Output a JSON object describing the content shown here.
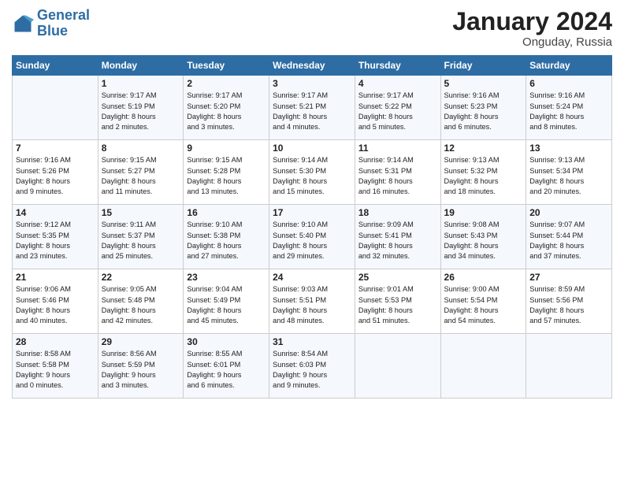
{
  "logo": {
    "line1": "General",
    "line2": "Blue"
  },
  "title": "January 2024",
  "location": "Onguday, Russia",
  "days_of_week": [
    "Sunday",
    "Monday",
    "Tuesday",
    "Wednesday",
    "Thursday",
    "Friday",
    "Saturday"
  ],
  "weeks": [
    [
      {
        "day": "",
        "info": ""
      },
      {
        "day": "1",
        "info": "Sunrise: 9:17 AM\nSunset: 5:19 PM\nDaylight: 8 hours\nand 2 minutes."
      },
      {
        "day": "2",
        "info": "Sunrise: 9:17 AM\nSunset: 5:20 PM\nDaylight: 8 hours\nand 3 minutes."
      },
      {
        "day": "3",
        "info": "Sunrise: 9:17 AM\nSunset: 5:21 PM\nDaylight: 8 hours\nand 4 minutes."
      },
      {
        "day": "4",
        "info": "Sunrise: 9:17 AM\nSunset: 5:22 PM\nDaylight: 8 hours\nand 5 minutes."
      },
      {
        "day": "5",
        "info": "Sunrise: 9:16 AM\nSunset: 5:23 PM\nDaylight: 8 hours\nand 6 minutes."
      },
      {
        "day": "6",
        "info": "Sunrise: 9:16 AM\nSunset: 5:24 PM\nDaylight: 8 hours\nand 8 minutes."
      }
    ],
    [
      {
        "day": "7",
        "info": "Sunrise: 9:16 AM\nSunset: 5:26 PM\nDaylight: 8 hours\nand 9 minutes."
      },
      {
        "day": "8",
        "info": "Sunrise: 9:15 AM\nSunset: 5:27 PM\nDaylight: 8 hours\nand 11 minutes."
      },
      {
        "day": "9",
        "info": "Sunrise: 9:15 AM\nSunset: 5:28 PM\nDaylight: 8 hours\nand 13 minutes."
      },
      {
        "day": "10",
        "info": "Sunrise: 9:14 AM\nSunset: 5:30 PM\nDaylight: 8 hours\nand 15 minutes."
      },
      {
        "day": "11",
        "info": "Sunrise: 9:14 AM\nSunset: 5:31 PM\nDaylight: 8 hours\nand 16 minutes."
      },
      {
        "day": "12",
        "info": "Sunrise: 9:13 AM\nSunset: 5:32 PM\nDaylight: 8 hours\nand 18 minutes."
      },
      {
        "day": "13",
        "info": "Sunrise: 9:13 AM\nSunset: 5:34 PM\nDaylight: 8 hours\nand 20 minutes."
      }
    ],
    [
      {
        "day": "14",
        "info": "Sunrise: 9:12 AM\nSunset: 5:35 PM\nDaylight: 8 hours\nand 23 minutes."
      },
      {
        "day": "15",
        "info": "Sunrise: 9:11 AM\nSunset: 5:37 PM\nDaylight: 8 hours\nand 25 minutes."
      },
      {
        "day": "16",
        "info": "Sunrise: 9:10 AM\nSunset: 5:38 PM\nDaylight: 8 hours\nand 27 minutes."
      },
      {
        "day": "17",
        "info": "Sunrise: 9:10 AM\nSunset: 5:40 PM\nDaylight: 8 hours\nand 29 minutes."
      },
      {
        "day": "18",
        "info": "Sunrise: 9:09 AM\nSunset: 5:41 PM\nDaylight: 8 hours\nand 32 minutes."
      },
      {
        "day": "19",
        "info": "Sunrise: 9:08 AM\nSunset: 5:43 PM\nDaylight: 8 hours\nand 34 minutes."
      },
      {
        "day": "20",
        "info": "Sunrise: 9:07 AM\nSunset: 5:44 PM\nDaylight: 8 hours\nand 37 minutes."
      }
    ],
    [
      {
        "day": "21",
        "info": "Sunrise: 9:06 AM\nSunset: 5:46 PM\nDaylight: 8 hours\nand 40 minutes."
      },
      {
        "day": "22",
        "info": "Sunrise: 9:05 AM\nSunset: 5:48 PM\nDaylight: 8 hours\nand 42 minutes."
      },
      {
        "day": "23",
        "info": "Sunrise: 9:04 AM\nSunset: 5:49 PM\nDaylight: 8 hours\nand 45 minutes."
      },
      {
        "day": "24",
        "info": "Sunrise: 9:03 AM\nSunset: 5:51 PM\nDaylight: 8 hours\nand 48 minutes."
      },
      {
        "day": "25",
        "info": "Sunrise: 9:01 AM\nSunset: 5:53 PM\nDaylight: 8 hours\nand 51 minutes."
      },
      {
        "day": "26",
        "info": "Sunrise: 9:00 AM\nSunset: 5:54 PM\nDaylight: 8 hours\nand 54 minutes."
      },
      {
        "day": "27",
        "info": "Sunrise: 8:59 AM\nSunset: 5:56 PM\nDaylight: 8 hours\nand 57 minutes."
      }
    ],
    [
      {
        "day": "28",
        "info": "Sunrise: 8:58 AM\nSunset: 5:58 PM\nDaylight: 9 hours\nand 0 minutes."
      },
      {
        "day": "29",
        "info": "Sunrise: 8:56 AM\nSunset: 5:59 PM\nDaylight: 9 hours\nand 3 minutes."
      },
      {
        "day": "30",
        "info": "Sunrise: 8:55 AM\nSunset: 6:01 PM\nDaylight: 9 hours\nand 6 minutes."
      },
      {
        "day": "31",
        "info": "Sunrise: 8:54 AM\nSunset: 6:03 PM\nDaylight: 9 hours\nand 9 minutes."
      },
      {
        "day": "",
        "info": ""
      },
      {
        "day": "",
        "info": ""
      },
      {
        "day": "",
        "info": ""
      }
    ]
  ]
}
